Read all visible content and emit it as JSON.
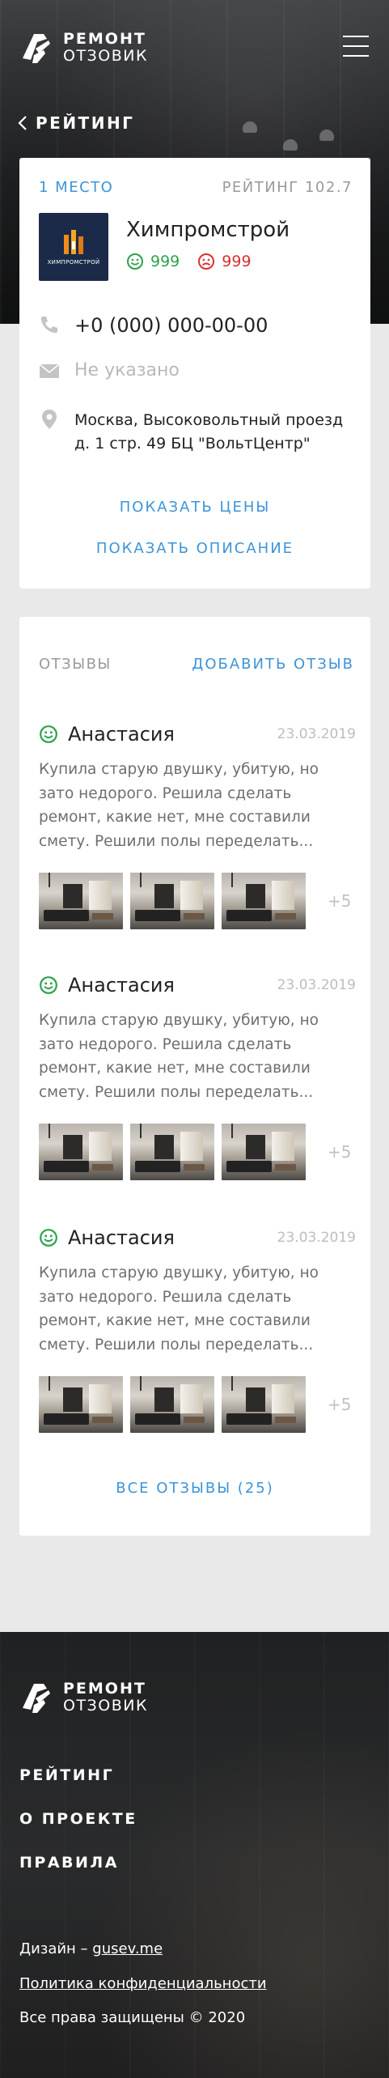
{
  "header": {
    "logo": {
      "line1": "РЕМОНТ",
      "line2": "ОТЗОВИК"
    },
    "back_label": "РЕЙТИНГ"
  },
  "company": {
    "place": "1 МЕСТО",
    "rating": "РЕЙТИНГ 102.7",
    "logo_caption": "ХИМПРОМСТРОЙ",
    "name": "Химпромстрой",
    "positive": "999",
    "negative": "999",
    "phone": "+0 (000) 000-00-00",
    "email": "Не указано",
    "address": "Москва, Высоковольтный проезд д. 1 стр. 49 БЦ \"ВольтЦентр\"",
    "show_prices": "ПОКАЗАТЬ ЦЕНЫ",
    "show_description": "ПОКАЗАТЬ ОПИСАНИЕ"
  },
  "reviews": {
    "title": "ОТЗЫВЫ",
    "add_label": "ДОБАВИТЬ ОТЗЫВ",
    "items": [
      {
        "author": "Анастасия",
        "date": "23.03.2019",
        "text": "Купила старую двушку, убитую, но зато недорого. Решила сделать ремонт, какие нет, мне составили смету. Решили полы переделать...",
        "more": "+5"
      },
      {
        "author": "Анастасия",
        "date": "23.03.2019",
        "text": "Купила старую двушку, убитую, но зато недорого. Решила сделать ремонт, какие нет, мне составили смету. Решили полы переделать...",
        "more": "+5"
      },
      {
        "author": "Анастасия",
        "date": "23.03.2019",
        "text": "Купила старую двушку, убитую, но зато недорого. Решила сделать ремонт, какие нет, мне составили смету. Решили полы переделать...",
        "more": "+5"
      }
    ],
    "all_label": "ВСЕ ОТЗЫВЫ (25)"
  },
  "footer": {
    "logo": {
      "line1": "РЕМОНТ",
      "line2": "ОТЗОВИК"
    },
    "nav": [
      "РЕЙТИНГ",
      "О ПРОЕКТЕ",
      "ПРАВИЛА"
    ],
    "design_prefix": "Дизайн – ",
    "design_link": "gusev.me",
    "privacy": "Политика конфиденциальности",
    "copyright": "Все права защищены © 2020"
  },
  "colors": {
    "accent": "#3d94d9",
    "positive": "#2aa34a",
    "negative": "#d6322f"
  },
  "icons": [
    "logo-roller-icon",
    "menu-icon",
    "chevron-left-icon",
    "smile-icon",
    "sad-icon",
    "phone-icon",
    "envelope-icon",
    "location-pin-icon"
  ]
}
